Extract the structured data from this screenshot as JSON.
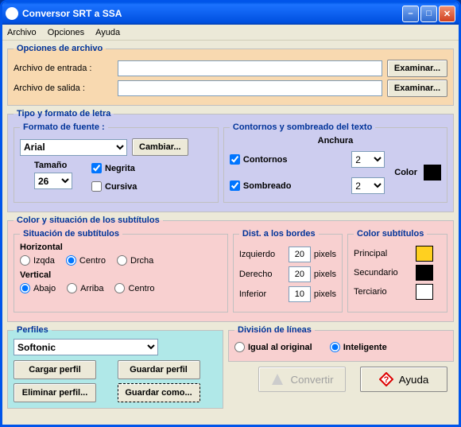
{
  "title": "Conversor SRT a SSA",
  "menu": {
    "archivo": "Archivo",
    "opciones": "Opciones",
    "ayuda": "Ayuda"
  },
  "file": {
    "legend": "Opciones de archivo",
    "in_label": "Archivo de entrada :",
    "in_value": "",
    "out_label": "Archivo de salida :",
    "out_value": "",
    "browse": "Examinar..."
  },
  "font": {
    "legend": "Tipo y formato de letra",
    "format_legend": "Formato de fuente  :",
    "font": "Arial",
    "change": "Cambiar...",
    "size_label": "Tamaño",
    "size": "26",
    "bold_label": "Negrita",
    "bold": true,
    "italic_label": "Cursiva",
    "italic": false,
    "outline_legend": "Contornos y sombreado del texto",
    "width_label": "Anchura",
    "outline_label": "Contornos",
    "outline": true,
    "outline_w": "2",
    "shadow_label": "Sombreado",
    "shadow": true,
    "shadow_w": "2",
    "color_label": "Color",
    "color": "#000000"
  },
  "pos": {
    "legend": "Color y situación de los subtítulos",
    "sit_legend": "Situación de subtítulos",
    "h_label": "Horizontal",
    "h_left": "Izqda",
    "h_center": "Centro",
    "h_right": "Drcha",
    "h_sel": "center",
    "v_label": "Vertical",
    "v_bottom": "Abajo",
    "v_top": "Arriba",
    "v_center": "Centro",
    "v_sel": "bottom",
    "dist_legend": "Dist. a los bordes",
    "left_label": "Izquierdo",
    "left": "20",
    "right_label": "Derecho",
    "right": "20",
    "bottom_label": "Inferior",
    "bottom": "10",
    "pixels": "pixels",
    "clr_legend": "Color subtítulos",
    "primary": "Principal",
    "primary_c": "#FFD020",
    "secondary": "Secundario",
    "secondary_c": "#000000",
    "tertiary": "Terciario",
    "tertiary_c": "#FFFFFF"
  },
  "profile": {
    "legend": "Perfiles",
    "selected": "Softonic",
    "load": "Cargar perfil",
    "save": "Guardar perfil",
    "delete": "Eliminar perfil...",
    "saveas": "Guardar como..."
  },
  "division": {
    "legend": "División de líneas",
    "orig": "Igual al original",
    "smart": "Inteligente",
    "sel": "smart"
  },
  "actions": {
    "convert": "Convertir",
    "help": "Ayuda"
  },
  "chart_data": null
}
